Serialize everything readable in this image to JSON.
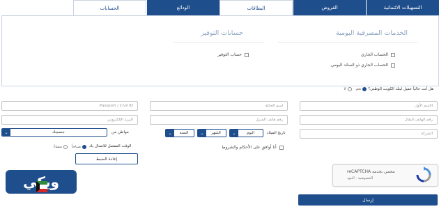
{
  "tabs": [
    {
      "label": "الحسابات"
    },
    {
      "label": "الودائع"
    },
    {
      "label": "البطاقات"
    },
    {
      "label": "القروض"
    },
    {
      "label": "التسهيلات الائتمانية"
    }
  ],
  "services": {
    "daily_title": "الخدمات المصرفية اليومية",
    "savings_title": "حسابات التوفير",
    "daily_options": [
      {
        "label": "الحساب الجاري",
        "checked": false
      },
      {
        "label": "الحساب الجاري ذو السائد اليومي",
        "checked": false
      }
    ],
    "savings_options": [
      {
        "label": "حساب التوفير",
        "checked": false
      }
    ]
  },
  "question": {
    "text": "هل أنت حالياً عميل لبنك الكويت الوطني؟",
    "yes_label": "نعم",
    "no_label": "لا",
    "selected": "yes"
  },
  "form": {
    "first_name_placeholder": "الاسم الأول",
    "last_name_placeholder": "اسم العائلة",
    "passport_placeholder": "Passport / Civil ID",
    "mobile_placeholder": "رقم الهاتف النقال",
    "branch_placeholder": "رقم هاتف المنزل",
    "email_placeholder": "البريد الإلكتروني",
    "company_placeholder": "الشركة",
    "dob_label": "تاريخ الميلاد",
    "dob_day": "اليوم",
    "dob_month": "الشهر",
    "dob_year": "السنة",
    "nationality_label": "مواطن من",
    "nationality_value": "جنسيتك",
    "contact_time_label": "الوقت المفضل للاتصال بك",
    "contact_options": [
      {
        "label": "صباحاً",
        "selected": true
      },
      {
        "label": "مساءً",
        "selected": false
      }
    ],
    "agree_label": "أنا أوافق على الأحكام والشروط",
    "reset_label": "إعادة الضبط",
    "submit_label": "إرسال"
  },
  "captcha": {
    "brand": "reCAPTCHA محمي بخدمة",
    "sub": "الخصوصية - البنود"
  },
  "watermark": {
    "text": "ويكي"
  },
  "colors": {
    "primary": "#1f4e8c",
    "title_muted": "#8fa6c3",
    "border": "#c6c6c6"
  }
}
